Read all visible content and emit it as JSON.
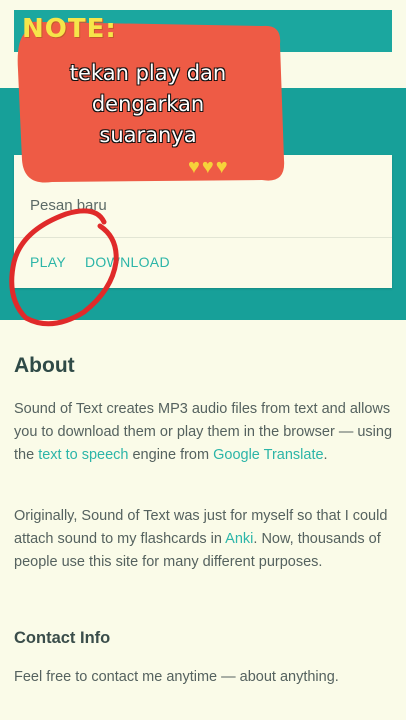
{
  "note": {
    "title": "NOTE:",
    "body": "tekan play dan dengarkan suaranya",
    "hearts": "♥♥♥"
  },
  "result": {
    "text": "Pesan baru",
    "play_label": "PLAY",
    "download_label": "DOWNLOAD"
  },
  "about": {
    "title": "About",
    "p1_a": "Sound of Text creates MP3 audio files from text and allows you to download them or play them in the browser — using the ",
    "p1_link1": "text to speech",
    "p1_b": " engine from ",
    "p1_link2": "Google Translate",
    "p1_c": ".",
    "p2_a": "Originally, Sound of Text was just for myself so that I could attach sound to my flashcards in ",
    "p2_link": "Anki",
    "p2_b": ". Now, thousands of people use this site for many different purposes."
  },
  "contact": {
    "title": "Contact Info",
    "text": "Feel free to contact me anytime — about anything."
  },
  "colors": {
    "teal": "#17a099",
    "link": "#2cb5a8",
    "note_red": "#ee5b45",
    "note_title": "#f6e64a",
    "circle_red": "#e02a2a"
  }
}
